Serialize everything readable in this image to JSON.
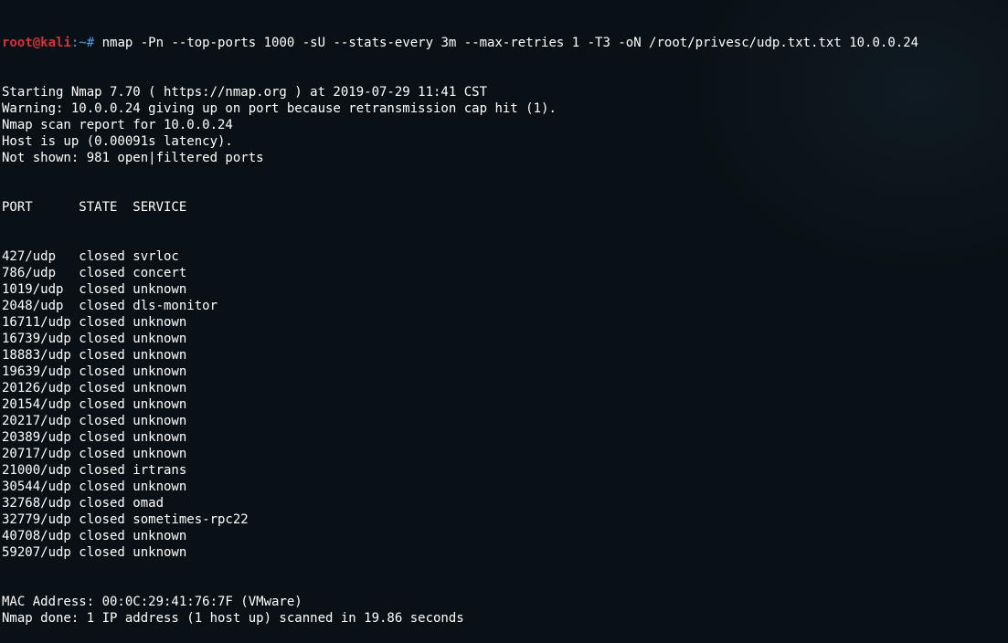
{
  "prompt": {
    "user": "root",
    "at": "@",
    "host": "kali",
    "rest": ":~#",
    "command": "nmap -Pn --top-ports 1000 -sU --stats-every 3m --max-retries 1 -T3 -oN /root/privesc/udp.txt.txt 10.0.0.24"
  },
  "preamble": [
    "Starting Nmap 7.70 ( https://nmap.org ) at 2019-07-29 11:41 CST",
    "Warning: 10.0.0.24 giving up on port because retransmission cap hit (1).",
    "Nmap scan report for 10.0.0.24",
    "Host is up (0.00091s latency).",
    "Not shown: 981 open|filtered ports"
  ],
  "header": {
    "port": "PORT",
    "state": "STATE",
    "service": "SERVICE"
  },
  "rows": [
    {
      "port": "427/udp",
      "state": "closed",
      "service": "svrloc"
    },
    {
      "port": "786/udp",
      "state": "closed",
      "service": "concert"
    },
    {
      "port": "1019/udp",
      "state": "closed",
      "service": "unknown"
    },
    {
      "port": "2048/udp",
      "state": "closed",
      "service": "dls-monitor"
    },
    {
      "port": "16711/udp",
      "state": "closed",
      "service": "unknown"
    },
    {
      "port": "16739/udp",
      "state": "closed",
      "service": "unknown"
    },
    {
      "port": "18883/udp",
      "state": "closed",
      "service": "unknown"
    },
    {
      "port": "19639/udp",
      "state": "closed",
      "service": "unknown"
    },
    {
      "port": "20126/udp",
      "state": "closed",
      "service": "unknown"
    },
    {
      "port": "20154/udp",
      "state": "closed",
      "service": "unknown"
    },
    {
      "port": "20217/udp",
      "state": "closed",
      "service": "unknown"
    },
    {
      "port": "20389/udp",
      "state": "closed",
      "service": "unknown"
    },
    {
      "port": "20717/udp",
      "state": "closed",
      "service": "unknown"
    },
    {
      "port": "21000/udp",
      "state": "closed",
      "service": "irtrans"
    },
    {
      "port": "30544/udp",
      "state": "closed",
      "service": "unknown"
    },
    {
      "port": "32768/udp",
      "state": "closed",
      "service": "omad"
    },
    {
      "port": "32779/udp",
      "state": "closed",
      "service": "sometimes-rpc22"
    },
    {
      "port": "40708/udp",
      "state": "closed",
      "service": "unknown"
    },
    {
      "port": "59207/udp",
      "state": "closed",
      "service": "unknown"
    }
  ],
  "postamble": [
    "MAC Address: 00:0C:29:41:76:7F (VMware)",
    "",
    "Nmap done: 1 IP address (1 host up) scanned in 19.86 seconds"
  ]
}
